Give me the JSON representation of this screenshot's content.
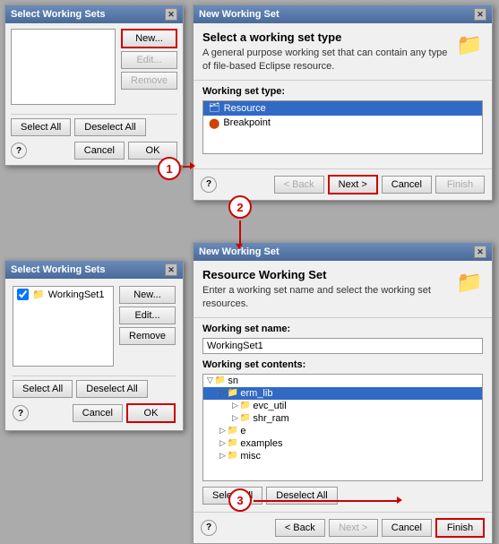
{
  "selectWsTop": {
    "title": "Select Working Sets",
    "listItems": [],
    "buttons": {
      "new": "New...",
      "edit": "Edit...",
      "remove": "Remove"
    },
    "selectAll": "Select All",
    "deselectAll": "Deselect All",
    "cancel": "Cancel",
    "ok": "OK"
  },
  "newWsPanel": {
    "title": "New Working Set",
    "sectionTitle": "Select a working set type",
    "description": "A general purpose working set that can contain any type of file-based Eclipse resource.",
    "sectionLabel": "Working set type:",
    "types": [
      {
        "label": "Resource",
        "selected": true
      },
      {
        "label": "Breakpoint",
        "selected": false
      }
    ],
    "nav": {
      "back": "< Back",
      "next": "Next >",
      "cancel": "Cancel",
      "finish": "Finish"
    }
  },
  "selectWsBottom": {
    "title": "Select Working Sets",
    "checkboxItems": [
      {
        "label": "WorkingSet1",
        "checked": true
      }
    ],
    "buttons": {
      "new": "New...",
      "edit": "Edit...",
      "remove": "Remove"
    },
    "selectAll": "Select All",
    "deselectAll": "Deselect All",
    "cancel": "Cancel",
    "ok": "OK"
  },
  "newWsResource": {
    "title": "New Working Set",
    "sectionTitle": "Resource Working Set",
    "description": "Enter a working set name and select the working set resources.",
    "nameLabel": "Working set name:",
    "nameValue": "WorkingSet1",
    "contentsLabel": "Working set contents:",
    "treeItems": [
      {
        "level": 1,
        "label": "sn",
        "hasExpand": true
      },
      {
        "level": 2,
        "label": "erm_lib",
        "hasExpand": false,
        "selected": true
      },
      {
        "level": 3,
        "label": "evc_util",
        "hasExpand": false
      },
      {
        "level": 3,
        "label": "shr_ram",
        "hasExpand": false
      },
      {
        "level": 2,
        "label": "e",
        "hasExpand": false
      },
      {
        "level": 2,
        "label": "examples",
        "hasExpand": false
      },
      {
        "level": 2,
        "label": "misc",
        "hasExpand": false
      }
    ],
    "selectAll": "Select All",
    "deselectAll": "Deselect All",
    "nav": {
      "back": "< Back",
      "next": "Next >",
      "cancel": "Cancel",
      "finish": "Finish"
    }
  },
  "steps": {
    "step1": "1",
    "step2": "2",
    "step3": "3"
  },
  "colors": {
    "red": "#cc0000",
    "blue": "#316ac5"
  }
}
